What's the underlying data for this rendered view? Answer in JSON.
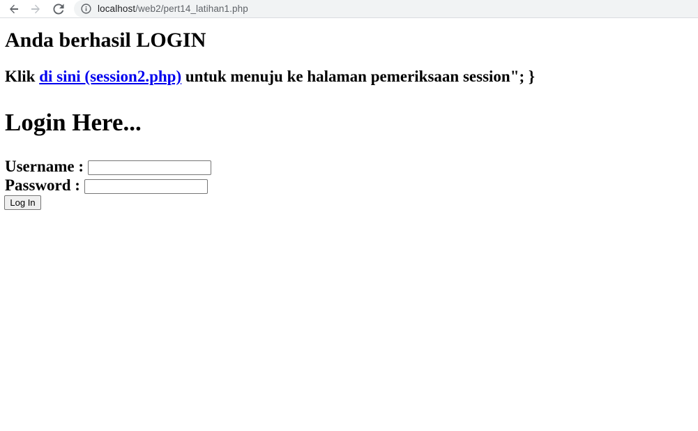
{
  "browser": {
    "url_host": "localhost",
    "url_path": "/web2/pert14_latihan1.php",
    "icons": {
      "back": "arrow-left-icon",
      "forward": "arrow-right-icon",
      "reload": "reload-icon",
      "info": "info-icon"
    }
  },
  "page": {
    "success_heading": "Anda berhasil LOGIN",
    "klik_prefix": "Klik ",
    "klik_link": "di sini (session2.php)",
    "klik_suffix": " untuk menuju ke halaman pemeriksaan session\"; }",
    "login_heading": "Login Here...",
    "username_label": "Username :",
    "username_value": "",
    "password_label": "Password :",
    "password_value": "",
    "login_button": "Log In"
  },
  "colors": {
    "link": "#0000ee",
    "text": "#000000",
    "omnibox_bg": "#f1f3f4"
  }
}
